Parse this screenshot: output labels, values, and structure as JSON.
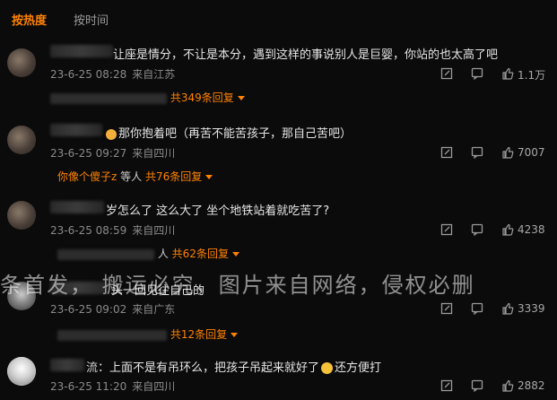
{
  "tabs": {
    "hot": "按热度",
    "time": "按时间"
  },
  "comments": [
    {
      "text": "让座是情分，不让是本分，遇到这样的事说别人是巨婴，你站的也太高了吧",
      "time": "23-6-25 08:28",
      "location": "来自江苏",
      "likes": "1.1万",
      "reply_users": "",
      "reply_count": "共349条回复"
    },
    {
      "text": "那你抱着吧（再苦不能苦孩子，那自己苦吧）",
      "time": "23-6-25 09:27",
      "location": "来自四川",
      "likes": "7007",
      "reply_users": "你像个傻子z",
      "reply_mid": "等人",
      "reply_count": "共76条回复"
    },
    {
      "text": "岁怎么了 这么大了 坐个地铁站着就吃苦了?",
      "time": "23-6-25 08:59",
      "location": "来自四川",
      "likes": "4238",
      "reply_mid": "人",
      "reply_count": "共62条回复"
    },
    {
      "text": "头一回见往自己的",
      "time": "23-6-25 09:02",
      "location": "来自广东",
      "likes": "3339",
      "reply_count": "共12条回复"
    },
    {
      "text_a": "上面不是有吊环么，把孩子吊起来就好了",
      "text_b": "还方便打",
      "name_suffix": "流",
      "time": "23-6-25 11:20",
      "location": "来自四川",
      "likes": "2882"
    }
  ],
  "watermark": "条首发， 搬运必究，图片来自网络，侵权必删",
  "colors": {
    "accent": "#ff8200",
    "background": "#0b0b0b"
  },
  "icons": [
    "reply-icon",
    "comment-icon",
    "like-icon",
    "caret-down-icon"
  ]
}
